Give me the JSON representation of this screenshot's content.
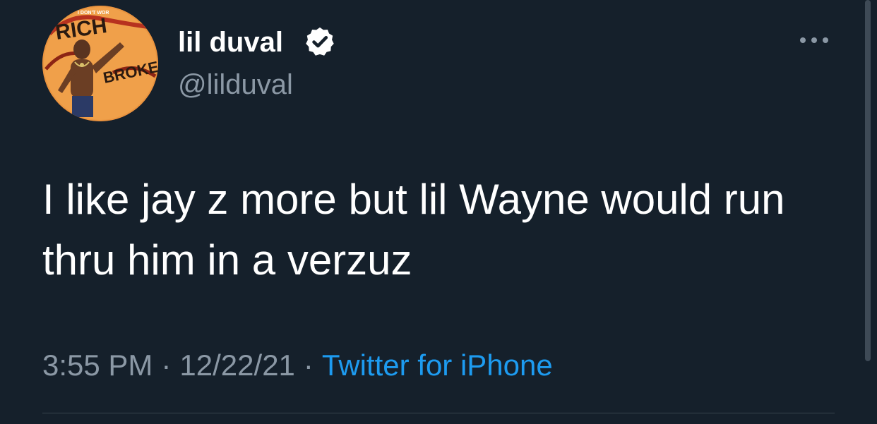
{
  "author": {
    "display_name": "lil duval",
    "handle": "@lilduval",
    "verified": true,
    "avatar_icon": "profile-photo",
    "avatar_banner_text": "I DON'T WOR",
    "avatar_graffiti_text": [
      "RICH",
      "BROKE"
    ]
  },
  "tweet": {
    "text": "I like jay z more but lil Wayne would run thru him in a verzuz",
    "time": "3:55 PM",
    "date": "12/22/21",
    "separator": "·",
    "source": "Twitter for iPhone"
  },
  "menu": {
    "icon": "more-horizontal-icon"
  },
  "colors": {
    "background": "#15202b",
    "primary_text": "#ffffff",
    "secondary_text": "#8b98a5",
    "link": "#1d9bf0",
    "divider": "#38444d"
  }
}
